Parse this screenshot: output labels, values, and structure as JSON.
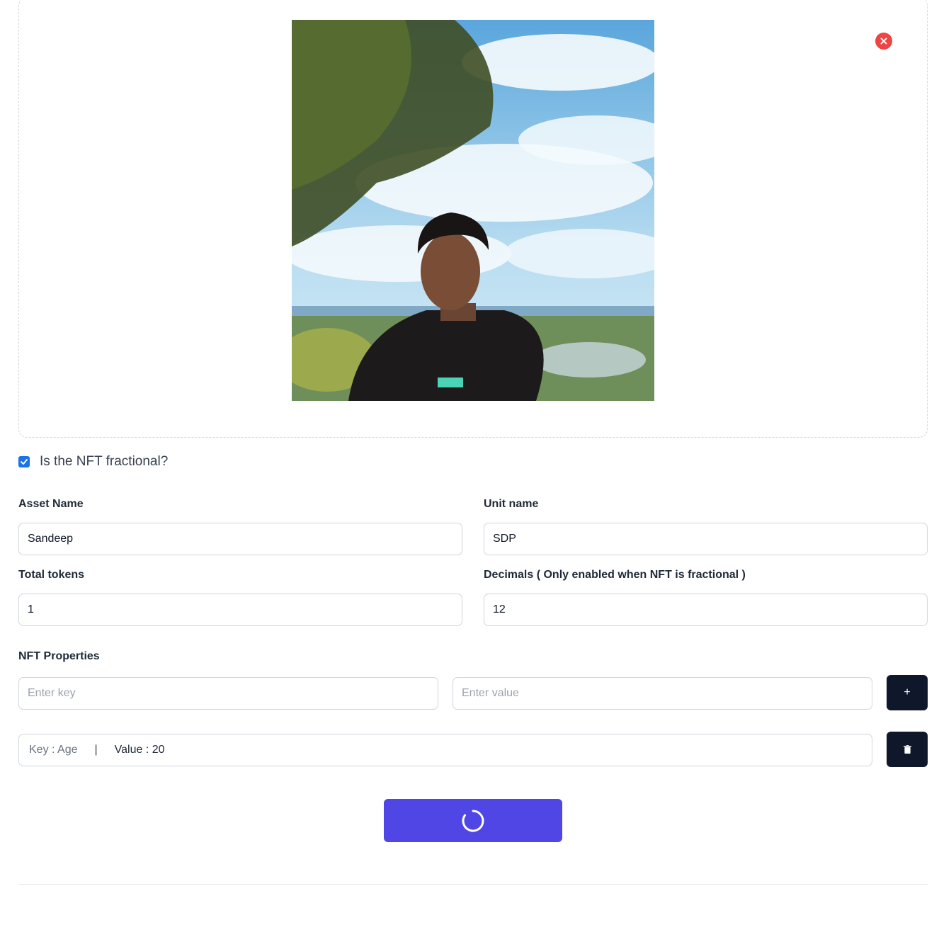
{
  "form": {
    "fractional_label": "Is the NFT fractional?",
    "fractional_checked": true,
    "asset_name_label": "Asset Name",
    "asset_name_value": "Sandeep",
    "unit_name_label": "Unit name",
    "unit_name_value": "SDP",
    "total_tokens_label": "Total tokens",
    "total_tokens_value": "1",
    "decimals_label": "Decimals ( Only enabled when NFT is fractional )",
    "decimals_value": "12"
  },
  "properties": {
    "section_label": "NFT Properties",
    "key_placeholder": "Enter key",
    "value_placeholder": "Enter value",
    "add_label": "+",
    "items": [
      {
        "key_text": "Key : Age",
        "separator": "|",
        "value_text": "Value : 20"
      }
    ]
  },
  "icons": {
    "remove": "close-circle-icon",
    "checkbox": "checkmark-icon",
    "delete": "trash-icon",
    "submit": "loading-spinner-icon"
  },
  "colors": {
    "remove_button": "#ef4444",
    "checkbox": "#1a73e8",
    "dark_button": "#0f172a",
    "submit_button": "#4f46e5"
  }
}
